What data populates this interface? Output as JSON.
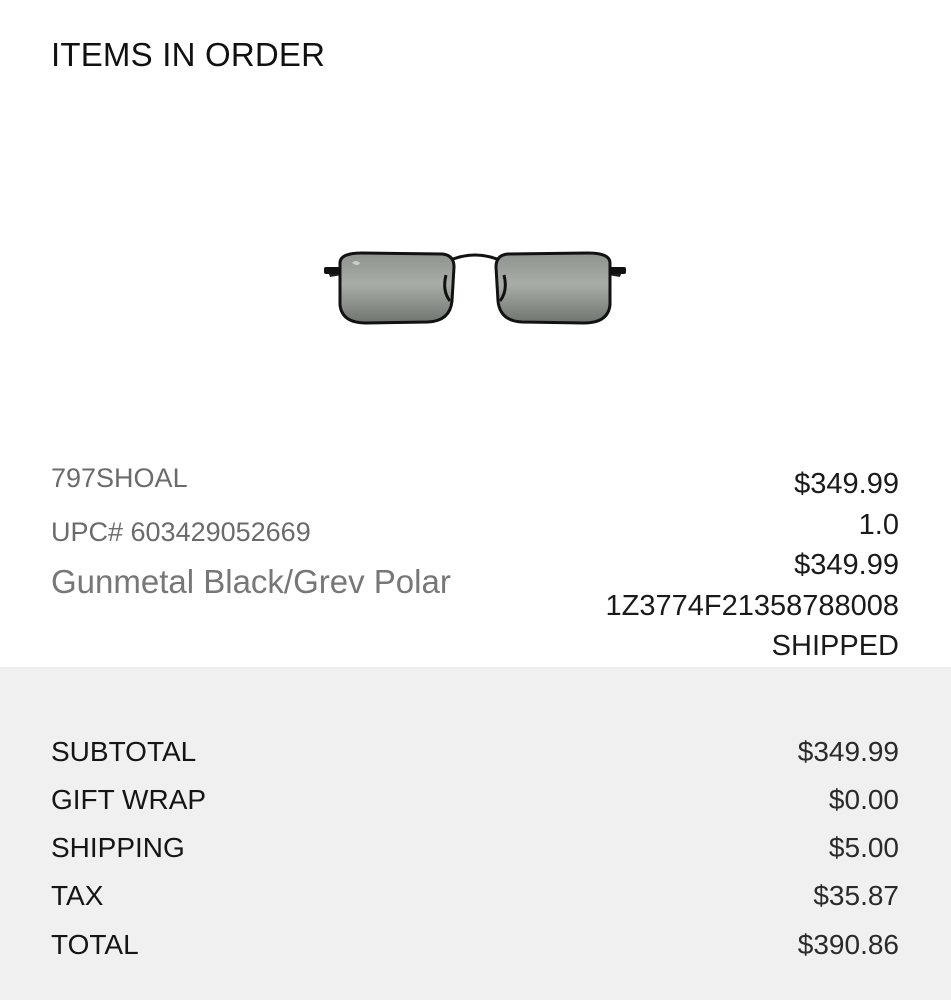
{
  "header": {
    "title": "ITEMS IN ORDER"
  },
  "item": {
    "image_icon": "sunglasses-product-image",
    "sku": "797SHOAL",
    "upc": "UPC# 603429052669",
    "variant": "Gunmetal Black/Grev Polar",
    "price": "$349.99",
    "quantity": "1.0",
    "line_total": "$349.99",
    "tracking_number": "1Z3774F21358788008",
    "status": "SHIPPED"
  },
  "summary": {
    "rows": [
      {
        "label": "SUBTOTAL",
        "value": "$349.99"
      },
      {
        "label": "GIFT WRAP",
        "value": "$0.00"
      },
      {
        "label": "SHIPPING",
        "value": "$5.00"
      },
      {
        "label": "TAX",
        "value": "$35.87"
      },
      {
        "label": "TOTAL",
        "value": "$390.86"
      }
    ]
  }
}
